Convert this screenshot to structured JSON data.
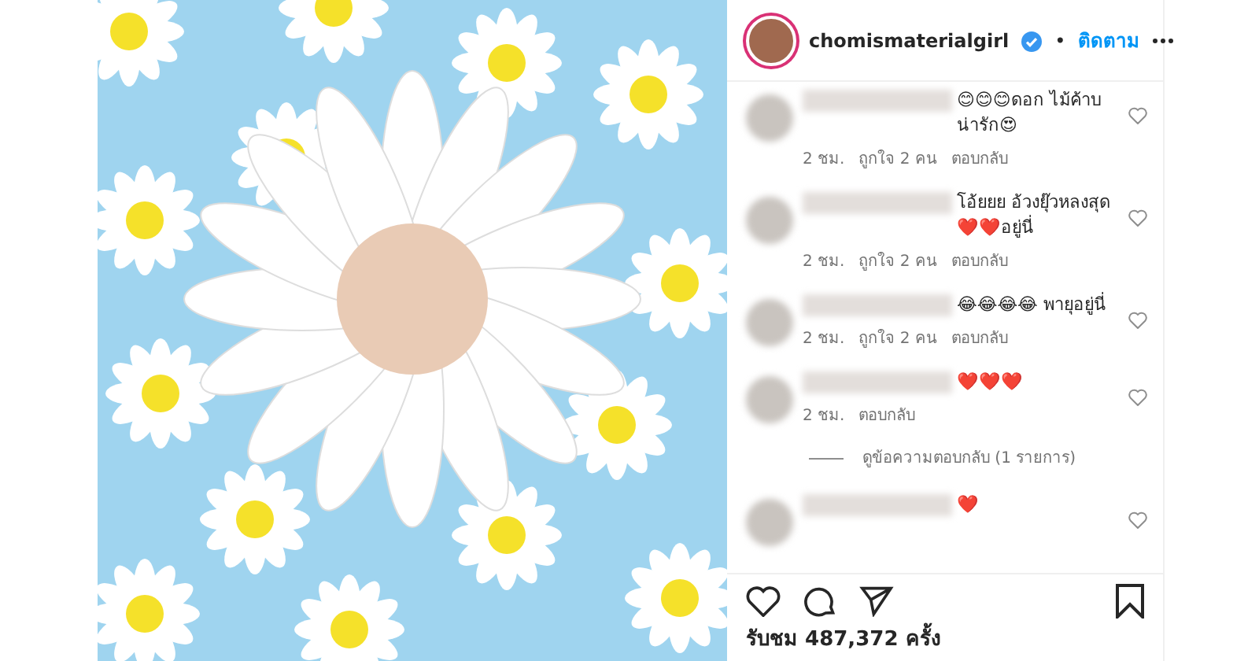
{
  "post": {
    "username": "chomismaterialgirl",
    "verified": true,
    "separator": "•",
    "follow": "ติดตาม"
  },
  "comments": [
    {
      "text": "😊😊😊ดอก ไม้ค้าบ น่ารัก😍",
      "time": "2 ชม.",
      "likes": "ถูกใจ 2 คน",
      "reply": "ตอบกลับ",
      "liked": false
    },
    {
      "text": "โอ้ยยย อ้วงยุ๊วหลงสุด ❤️❤️อยู่นี่",
      "time": "2 ชม.",
      "likes": "ถูกใจ 2 คน",
      "reply": "ตอบกลับ",
      "liked": false
    },
    {
      "text": "😂😂😂😂 พายุอยู่นี่",
      "time": "2 ชม.",
      "likes": "ถูกใจ 2 คน",
      "reply": "ตอบกลับ",
      "liked": false
    },
    {
      "text": "❤️❤️❤️",
      "time": "2 ชม.",
      "reply": "ตอบกลับ",
      "liked": false,
      "view_replies": "ดูข้อความตอบกลับ (1 รายการ)"
    },
    {
      "text": "❤️",
      "liked": false
    }
  ],
  "views": "รับชม 487,372 ครั้ง"
}
